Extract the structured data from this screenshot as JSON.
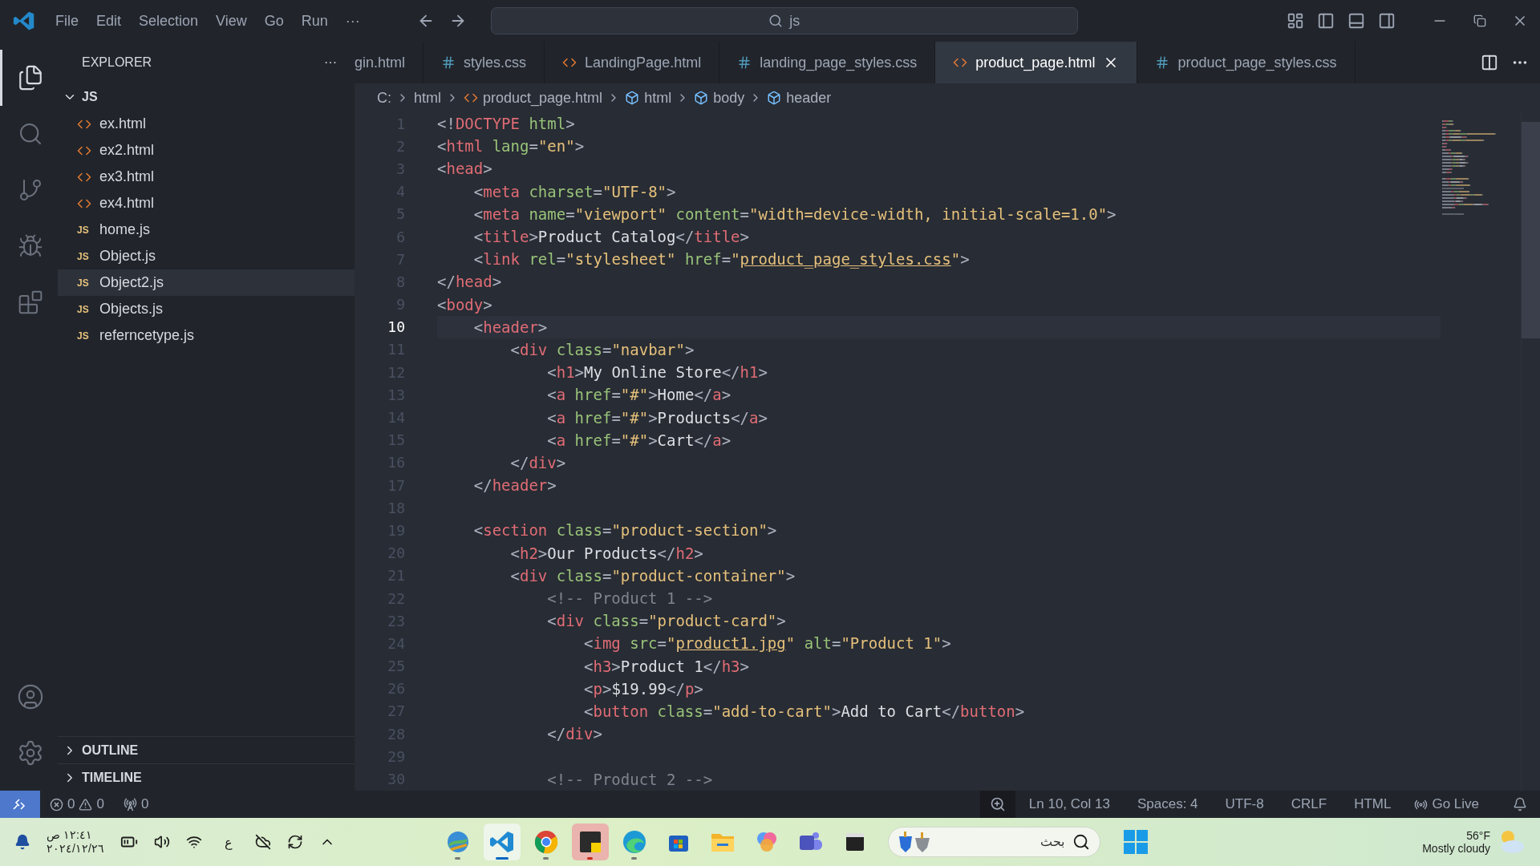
{
  "title_bar": {
    "menus": [
      "File",
      "Edit",
      "Selection",
      "View",
      "Go",
      "Run",
      "···"
    ],
    "search": {
      "value": "js"
    }
  },
  "activity_bar": [
    {
      "kind": "explorer",
      "selected": true
    },
    {
      "kind": "search",
      "selected": false
    },
    {
      "kind": "source-control",
      "selected": false
    },
    {
      "kind": "run",
      "selected": false
    },
    {
      "kind": "extensions",
      "selected": false
    }
  ],
  "sidebar": {
    "title": "EXPLORER",
    "more": "···",
    "folder": {
      "name": "JS",
      "expanded": true,
      "files": [
        {
          "kind": "html",
          "name": "ex.html",
          "selected": false
        },
        {
          "kind": "html",
          "name": "ex2.html",
          "selected": false
        },
        {
          "kind": "html",
          "name": "ex3.html",
          "selected": false
        },
        {
          "kind": "html",
          "name": "ex4.html",
          "selected": false
        },
        {
          "kind": "js",
          "badge": "JS",
          "name": "home.js",
          "selected": false
        },
        {
          "kind": "js",
          "badge": "JS",
          "name": "Object.js",
          "selected": false
        },
        {
          "kind": "js",
          "badge": "JS",
          "name": "Object2.js",
          "selected": true
        },
        {
          "kind": "js",
          "badge": "JS",
          "name": "Objects.js",
          "selected": false
        },
        {
          "kind": "js",
          "badge": "JS",
          "name": "referncetype.js",
          "selected": false
        }
      ]
    },
    "sections": [
      {
        "name": "OUTLINE",
        "expanded": false
      },
      {
        "name": "TIMELINE",
        "expanded": false
      }
    ]
  },
  "tabs": [
    {
      "kind": "plain",
      "label": "gin.html",
      "selected": false
    },
    {
      "kind": "css",
      "label": "styles.css",
      "selected": false
    },
    {
      "kind": "html",
      "label": "LandingPage.html",
      "selected": false
    },
    {
      "kind": "css",
      "label": "landing_page_styles.css",
      "selected": false
    },
    {
      "kind": "html",
      "label": "product_page.html",
      "selected": true
    },
    {
      "kind": "css",
      "label": "product_page_styles.css",
      "selected": false
    }
  ],
  "breadcrumb": [
    {
      "kind": "folder",
      "label": "C:"
    },
    {
      "kind": "folder",
      "label": "html"
    },
    {
      "kind": "file",
      "label": "product_page.html"
    },
    {
      "kind": "element",
      "label": "html"
    },
    {
      "kind": "element",
      "label": "body"
    },
    {
      "kind": "element",
      "label": "header"
    }
  ],
  "editor": {
    "lines": [
      {
        "number": "1",
        "current": false,
        "tokens": [
          {
            "kind": "p",
            "text": "<!"
          },
          {
            "kind": "tag",
            "text": "DOCTYPE"
          },
          {
            "kind": "attr",
            "text": " html"
          },
          {
            "kind": "p",
            "text": ">"
          }
        ]
      },
      {
        "number": "2",
        "current": false,
        "tokens": [
          {
            "kind": "p",
            "text": "<"
          },
          {
            "kind": "tag",
            "text": "html"
          },
          {
            "kind": "attr",
            "text": " lang"
          },
          {
            "kind": "p",
            "text": "="
          },
          {
            "kind": "str",
            "text": "\"en\""
          },
          {
            "kind": "p",
            "text": ">"
          }
        ]
      },
      {
        "number": "3",
        "current": false,
        "tokens": [
          {
            "kind": "p",
            "text": "<"
          },
          {
            "kind": "tag",
            "text": "head"
          },
          {
            "kind": "p",
            "text": ">"
          }
        ]
      },
      {
        "number": "4",
        "current": false,
        "tokens": [
          {
            "kind": "p",
            "text": "    <"
          },
          {
            "kind": "tag",
            "text": "meta"
          },
          {
            "kind": "attr",
            "text": " charset"
          },
          {
            "kind": "p",
            "text": "="
          },
          {
            "kind": "str",
            "text": "\"UTF-8\""
          },
          {
            "kind": "p",
            "text": ">"
          }
        ]
      },
      {
        "number": "5",
        "current": false,
        "tokens": [
          {
            "kind": "p",
            "text": "    <"
          },
          {
            "kind": "tag",
            "text": "meta"
          },
          {
            "kind": "attr",
            "text": " name"
          },
          {
            "kind": "p",
            "text": "="
          },
          {
            "kind": "str",
            "text": "\"viewport\""
          },
          {
            "kind": "attr",
            "text": " content"
          },
          {
            "kind": "p",
            "text": "="
          },
          {
            "kind": "str",
            "text": "\"width=device-width, initial-scale=1.0\""
          },
          {
            "kind": "p",
            "text": ">"
          }
        ]
      },
      {
        "number": "6",
        "current": false,
        "tokens": [
          {
            "kind": "p",
            "text": "    <"
          },
          {
            "kind": "tag",
            "text": "title"
          },
          {
            "kind": "p",
            "text": ">"
          },
          {
            "kind": "text",
            "text": "Product Catalog"
          },
          {
            "kind": "p",
            "text": "</"
          },
          {
            "kind": "tag",
            "text": "title"
          },
          {
            "kind": "p",
            "text": ">"
          }
        ]
      },
      {
        "number": "7",
        "current": false,
        "tokens": [
          {
            "kind": "p",
            "text": "    <"
          },
          {
            "kind": "tag",
            "text": "link"
          },
          {
            "kind": "attr",
            "text": " rel"
          },
          {
            "kind": "p",
            "text": "="
          },
          {
            "kind": "str",
            "text": "\"stylesheet\""
          },
          {
            "kind": "attr",
            "text": " href"
          },
          {
            "kind": "p",
            "text": "="
          },
          {
            "kind": "str",
            "text": "\""
          },
          {
            "kind": "link",
            "text": "product_page_styles.css"
          },
          {
            "kind": "str",
            "text": "\""
          },
          {
            "kind": "p",
            "text": ">"
          }
        ]
      },
      {
        "number": "8",
        "current": false,
        "tokens": [
          {
            "kind": "p",
            "text": "</"
          },
          {
            "kind": "tag",
            "text": "head"
          },
          {
            "kind": "p",
            "text": ">"
          }
        ]
      },
      {
        "number": "9",
        "current": false,
        "tokens": [
          {
            "kind": "p",
            "text": "<"
          },
          {
            "kind": "tag",
            "text": "body"
          },
          {
            "kind": "p",
            "text": ">"
          }
        ]
      },
      {
        "number": "10",
        "current": true,
        "tokens": [
          {
            "kind": "p",
            "text": "    <"
          },
          {
            "kind": "tag",
            "text": "header"
          },
          {
            "kind": "p",
            "text": ">"
          }
        ]
      },
      {
        "number": "11",
        "current": false,
        "tokens": [
          {
            "kind": "p",
            "text": "        <"
          },
          {
            "kind": "tag",
            "text": "div"
          },
          {
            "kind": "attr",
            "text": " class"
          },
          {
            "kind": "p",
            "text": "="
          },
          {
            "kind": "str",
            "text": "\"navbar\""
          },
          {
            "kind": "p",
            "text": ">"
          }
        ]
      },
      {
        "number": "12",
        "current": false,
        "tokens": [
          {
            "kind": "p",
            "text": "            <"
          },
          {
            "kind": "tag",
            "text": "h1"
          },
          {
            "kind": "p",
            "text": ">"
          },
          {
            "kind": "text",
            "text": "My Online Store"
          },
          {
            "kind": "p",
            "text": "</"
          },
          {
            "kind": "tag",
            "text": "h1"
          },
          {
            "kind": "p",
            "text": ">"
          }
        ]
      },
      {
        "number": "13",
        "current": false,
        "tokens": [
          {
            "kind": "p",
            "text": "            <"
          },
          {
            "kind": "tag",
            "text": "a"
          },
          {
            "kind": "attr",
            "text": " href"
          },
          {
            "kind": "p",
            "text": "="
          },
          {
            "kind": "str",
            "text": "\"#\""
          },
          {
            "kind": "p",
            "text": ">"
          },
          {
            "kind": "text",
            "text": "Home"
          },
          {
            "kind": "p",
            "text": "</"
          },
          {
            "kind": "tag",
            "text": "a"
          },
          {
            "kind": "p",
            "text": ">"
          }
        ]
      },
      {
        "number": "14",
        "current": false,
        "tokens": [
          {
            "kind": "p",
            "text": "            <"
          },
          {
            "kind": "tag",
            "text": "a"
          },
          {
            "kind": "attr",
            "text": " href"
          },
          {
            "kind": "p",
            "text": "="
          },
          {
            "kind": "str",
            "text": "\"#\""
          },
          {
            "kind": "p",
            "text": ">"
          },
          {
            "kind": "text",
            "text": "Products"
          },
          {
            "kind": "p",
            "text": "</"
          },
          {
            "kind": "tag",
            "text": "a"
          },
          {
            "kind": "p",
            "text": ">"
          }
        ]
      },
      {
        "number": "15",
        "current": false,
        "tokens": [
          {
            "kind": "p",
            "text": "            <"
          },
          {
            "kind": "tag",
            "text": "a"
          },
          {
            "kind": "attr",
            "text": " href"
          },
          {
            "kind": "p",
            "text": "="
          },
          {
            "kind": "str",
            "text": "\"#\""
          },
          {
            "kind": "p",
            "text": ">"
          },
          {
            "kind": "text",
            "text": "Cart"
          },
          {
            "kind": "p",
            "text": "</"
          },
          {
            "kind": "tag",
            "text": "a"
          },
          {
            "kind": "p",
            "text": ">"
          }
        ]
      },
      {
        "number": "16",
        "current": false,
        "tokens": [
          {
            "kind": "p",
            "text": "        </"
          },
          {
            "kind": "tag",
            "text": "div"
          },
          {
            "kind": "p",
            "text": ">"
          }
        ]
      },
      {
        "number": "17",
        "current": false,
        "tokens": [
          {
            "kind": "p",
            "text": "    </"
          },
          {
            "kind": "tag",
            "text": "header"
          },
          {
            "kind": "p",
            "text": ">"
          }
        ]
      },
      {
        "number": "18",
        "current": false
      },
      {
        "number": "19",
        "current": false,
        "tokens": [
          {
            "kind": "p",
            "text": "    <"
          },
          {
            "kind": "tag",
            "text": "section"
          },
          {
            "kind": "attr",
            "text": " class"
          },
          {
            "kind": "p",
            "text": "="
          },
          {
            "kind": "str",
            "text": "\"product-section\""
          },
          {
            "kind": "p",
            "text": ">"
          }
        ]
      },
      {
        "number": "20",
        "current": false,
        "tokens": [
          {
            "kind": "p",
            "text": "        <"
          },
          {
            "kind": "tag",
            "text": "h2"
          },
          {
            "kind": "p",
            "text": ">"
          },
          {
            "kind": "text",
            "text": "Our Products"
          },
          {
            "kind": "p",
            "text": "</"
          },
          {
            "kind": "tag",
            "text": "h2"
          },
          {
            "kind": "p",
            "text": ">"
          }
        ]
      },
      {
        "number": "21",
        "current": false,
        "tokens": [
          {
            "kind": "p",
            "text": "        <"
          },
          {
            "kind": "tag",
            "text": "div"
          },
          {
            "kind": "attr",
            "text": " class"
          },
          {
            "kind": "p",
            "text": "="
          },
          {
            "kind": "str",
            "text": "\"product-container\""
          },
          {
            "kind": "p",
            "text": ">"
          }
        ]
      },
      {
        "number": "22",
        "current": false,
        "tokens": [
          {
            "kind": "comment",
            "text": "            <!-- Product 1 -->"
          }
        ]
      },
      {
        "number": "23",
        "current": false,
        "tokens": [
          {
            "kind": "p",
            "text": "            <"
          },
          {
            "kind": "tag",
            "text": "div"
          },
          {
            "kind": "attr",
            "text": " class"
          },
          {
            "kind": "p",
            "text": "="
          },
          {
            "kind": "str",
            "text": "\"product-card\""
          },
          {
            "kind": "p",
            "text": ">"
          }
        ]
      },
      {
        "number": "24",
        "current": false,
        "tokens": [
          {
            "kind": "p",
            "text": "                <"
          },
          {
            "kind": "tag",
            "text": "img"
          },
          {
            "kind": "attr",
            "text": " src"
          },
          {
            "kind": "p",
            "text": "="
          },
          {
            "kind": "str",
            "text": "\""
          },
          {
            "kind": "link",
            "text": "product1.jpg"
          },
          {
            "kind": "str",
            "text": "\""
          },
          {
            "kind": "attr",
            "text": " alt"
          },
          {
            "kind": "p",
            "text": "="
          },
          {
            "kind": "str",
            "text": "\"Product 1\""
          },
          {
            "kind": "p",
            "text": ">"
          }
        ]
      },
      {
        "number": "25",
        "current": false,
        "tokens": [
          {
            "kind": "p",
            "text": "                <"
          },
          {
            "kind": "tag",
            "text": "h3"
          },
          {
            "kind": "p",
            "text": ">"
          },
          {
            "kind": "text",
            "text": "Product 1"
          },
          {
            "kind": "p",
            "text": "</"
          },
          {
            "kind": "tag",
            "text": "h3"
          },
          {
            "kind": "p",
            "text": ">"
          }
        ]
      },
      {
        "number": "26",
        "current": false,
        "tokens": [
          {
            "kind": "p",
            "text": "                <"
          },
          {
            "kind": "tag",
            "text": "p"
          },
          {
            "kind": "p",
            "text": ">"
          },
          {
            "kind": "text",
            "text": "$19.99"
          },
          {
            "kind": "p",
            "text": "</"
          },
          {
            "kind": "tag",
            "text": "p"
          },
          {
            "kind": "p",
            "text": ">"
          }
        ]
      },
      {
        "number": "27",
        "current": false,
        "tokens": [
          {
            "kind": "p",
            "text": "                <"
          },
          {
            "kind": "tag",
            "text": "button"
          },
          {
            "kind": "attr",
            "text": " class"
          },
          {
            "kind": "p",
            "text": "="
          },
          {
            "kind": "str",
            "text": "\"add-to-cart\""
          },
          {
            "kind": "p",
            "text": ">"
          },
          {
            "kind": "text",
            "text": "Add to Cart"
          },
          {
            "kind": "p",
            "text": "</"
          },
          {
            "kind": "tag",
            "text": "button"
          },
          {
            "kind": "p",
            "text": ">"
          }
        ]
      },
      {
        "number": "28",
        "current": false,
        "tokens": [
          {
            "kind": "p",
            "text": "            </"
          },
          {
            "kind": "tag",
            "text": "div"
          },
          {
            "kind": "p",
            "text": ">"
          }
        ]
      },
      {
        "number": "29",
        "current": false
      },
      {
        "number": "30",
        "current": false,
        "tokens": [
          {
            "kind": "comment",
            "text": "            <!-- Product 2 -->"
          }
        ]
      }
    ]
  },
  "status_bar": {
    "errors": "0",
    "warnings": "0",
    "ports": "0",
    "items": [
      "Ln 10, Col 13",
      "Spaces: 4",
      "UTF-8",
      "CRLF",
      "HTML"
    ],
    "go_live": "Go Live"
  },
  "taskbar": {
    "time": "١٢:٤١ ص",
    "date": "٢٠٢٤/١٢/٢٦",
    "language": "ع",
    "apps": [
      {
        "kind": "globe",
        "running": true,
        "active": false,
        "flashing": false
      },
      {
        "kind": "code",
        "running": true,
        "active": true,
        "flashing": false
      },
      {
        "kind": "chrome",
        "running": true,
        "active": false,
        "flashing": false
      },
      {
        "kind": "notes",
        "running": true,
        "active": false,
        "flashing": true
      },
      {
        "kind": "edge",
        "running": true,
        "active": false,
        "flashing": false
      },
      {
        "kind": "store",
        "running": false,
        "active": false,
        "flashing": false
      },
      {
        "kind": "folder",
        "running": false,
        "active": false,
        "flashing": false
      },
      {
        "kind": "clover",
        "running": false,
        "active": false,
        "flashing": false
      },
      {
        "kind": "teams",
        "running": false,
        "active": false,
        "flashing": false
      },
      {
        "kind": "terminal",
        "running": false,
        "active": false,
        "flashing": false
      }
    ],
    "search": {
      "placeholder": "بحث"
    },
    "weather": {
      "temperature": "56°F",
      "condition": "Mostly cloudy"
    }
  }
}
